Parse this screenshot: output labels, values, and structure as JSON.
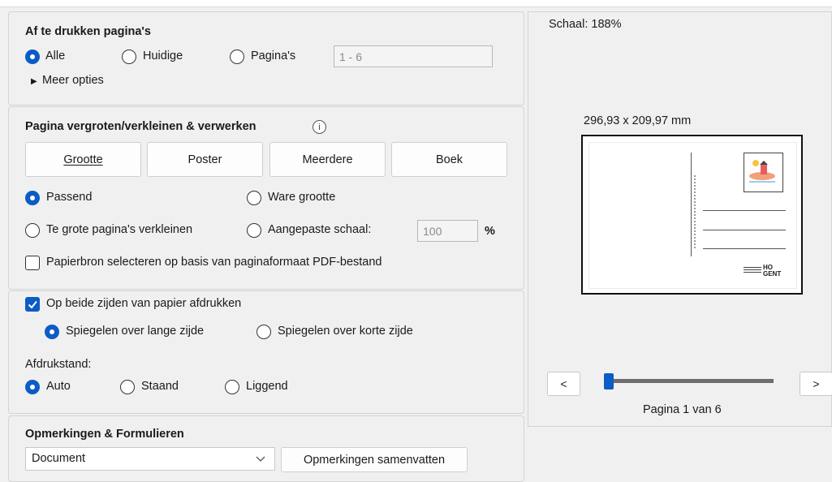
{
  "pages_section": {
    "title": "Af te drukken pagina's",
    "options": [
      "Alle",
      "Huidige",
      "Pagina's"
    ],
    "range_value": "1 - 6",
    "more_options": "Meer opties"
  },
  "scale_section": {
    "title": "Pagina vergroten/verkleinen & verwerken",
    "buttons": [
      "Grootte",
      "Poster",
      "Meerdere",
      "Boek"
    ],
    "fit_label": "Passend",
    "actual_size_label": "Ware grootte",
    "shrink_label": "Te grote pagina's verkleinen",
    "custom_scale_label": "Aangepaste schaal:",
    "custom_scale_value": "100",
    "percent": "%",
    "paper_source_label": "Papierbron selecteren op basis van paginaformaat PDF-bestand"
  },
  "duplex_section": {
    "duplex_label": "Op beide zijden van papier afdrukken",
    "flip_long": "Spiegelen over lange zijde",
    "flip_short": "Spiegelen over korte zijde",
    "orientation_label": "Afdrukstand:",
    "orientations": [
      "Auto",
      "Staand",
      "Liggend"
    ]
  },
  "comments_section": {
    "title": "Opmerkingen & Formulieren",
    "select_value": "Document",
    "summarize_button": "Opmerkingen samenvatten"
  },
  "preview": {
    "scale": "Schaal: 188%",
    "dimensions": "296,93 x 209,97 mm",
    "prev": "<",
    "next": ">",
    "page_status": "Pagina 1 van 6",
    "page_position": 0.0,
    "logo_text": "HO GENT"
  },
  "colors": {
    "accent": "#0b5cc5"
  }
}
